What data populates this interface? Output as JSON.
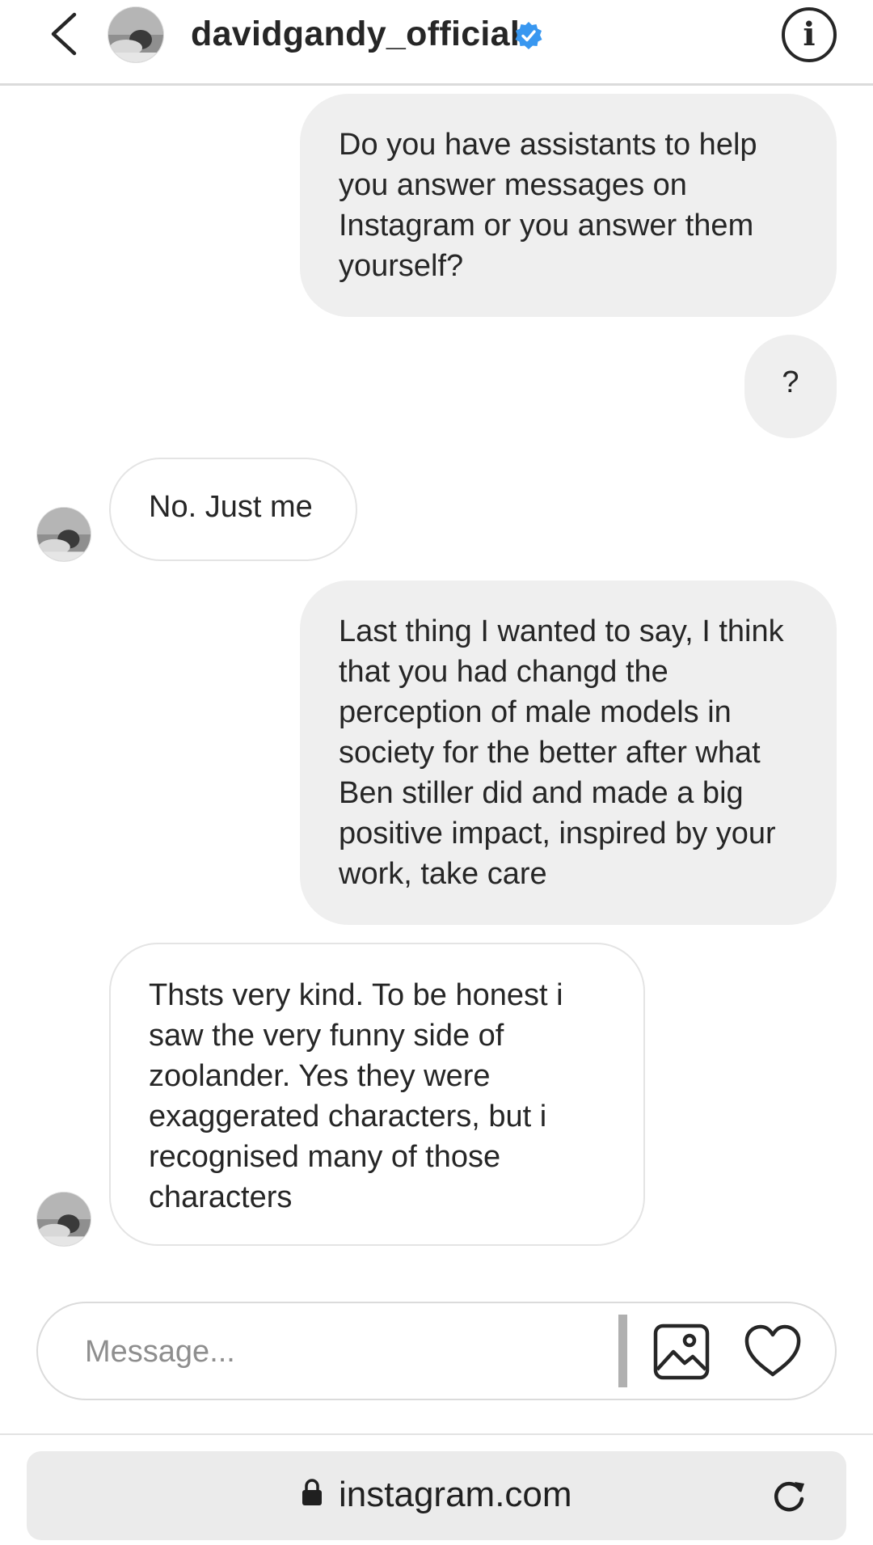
{
  "header": {
    "username": "davidgandy_official",
    "verified": true
  },
  "messages": [
    {
      "from": "me",
      "text": "Do you have assistants to help you answer messages on Instagram or you answer them yourself?"
    },
    {
      "from": "me",
      "text": "?"
    },
    {
      "from": "them",
      "text": "No. Just me"
    },
    {
      "from": "me",
      "text": "Last thing I wanted to say, I think that you had changd the perception of male models in society for the better after what Ben stiller did and made a big positive impact, inspired by your work, take care"
    },
    {
      "from": "them",
      "text": "Thsts very kind. To be honest i saw the very funny side of zoolander. Yes they were exaggerated characters, but i recognised many of those characters"
    }
  ],
  "composer": {
    "placeholder": "Message...",
    "value": ""
  },
  "browser": {
    "url": "instagram.com"
  },
  "colors": {
    "sent_bubble": "#efefef",
    "verified_blue": "#3897f0",
    "text": "#262626"
  }
}
